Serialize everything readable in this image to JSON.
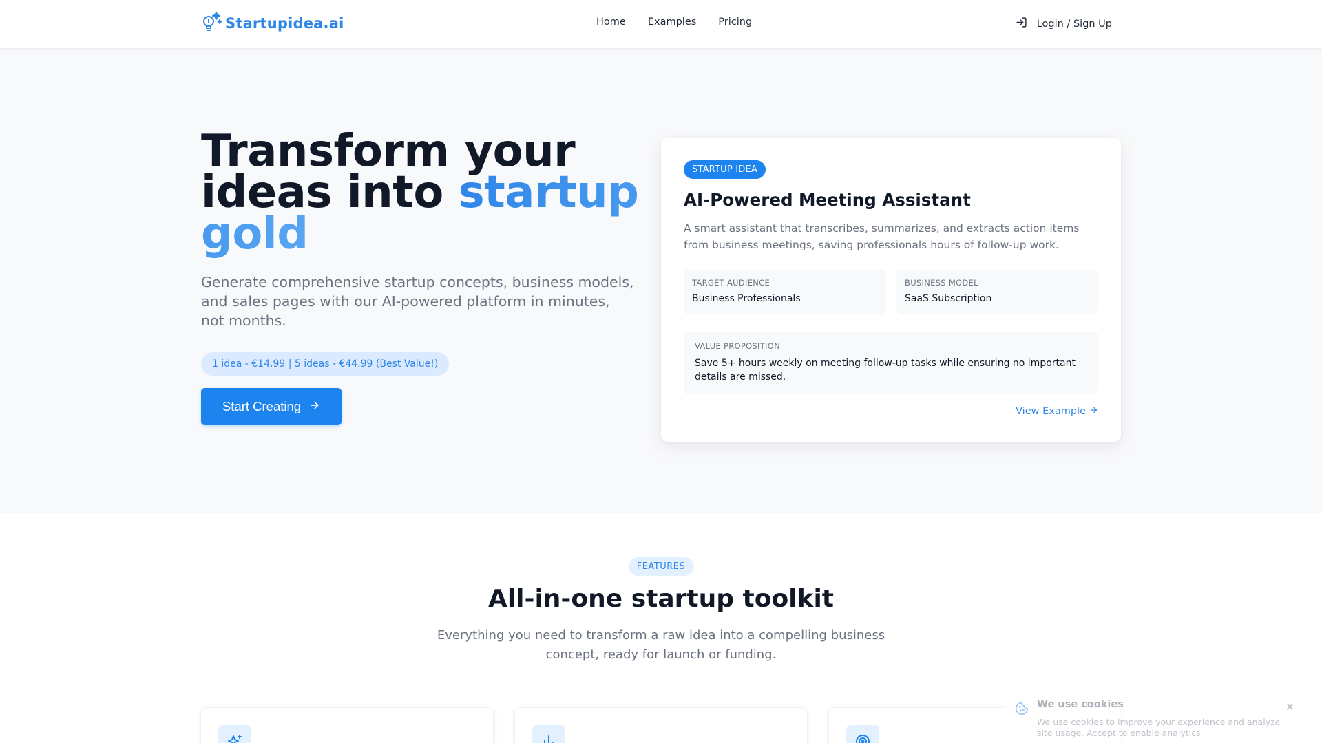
{
  "nav": {
    "logo_text": "Startupidea.ai",
    "links": [
      "Home",
      "Examples",
      "Pricing"
    ],
    "login_label": "Login / Sign Up"
  },
  "hero": {
    "title_line1": "Transform your",
    "title_line2_plain": "ideas into",
    "title_accent": "startup gold",
    "subtitle": "Generate comprehensive startup concepts, business models, and sales pages with our AI-powered platform in minutes, not months.",
    "pricing_pill": "1 idea - €14.99 | 5 ideas - €44.99 (Best Value!)",
    "cta_label": "Start Creating"
  },
  "idea_card": {
    "badge": "STARTUP IDEA",
    "title": "AI-Powered Meeting Assistant",
    "description": "A smart assistant that transcribes, summarizes, and extracts action items from business meetings, saving professionals hours of follow-up work.",
    "target_audience_label": "TARGET AUDIENCE",
    "target_audience_value": "Business Professionals",
    "business_model_label": "BUSINESS MODEL",
    "business_model_value": "SaaS Subscription",
    "value_prop_label": "VALUE PROPOSITION",
    "value_prop_value": "Save 5+ hours weekly on meeting follow-up tasks while ensuring no important details are missed.",
    "link_label": "View Example"
  },
  "features": {
    "pill": "FEATURES",
    "title": "All-in-one startup toolkit",
    "subtitle": "Everything you need to transform a raw idea into a compelling business concept, ready for launch or funding.",
    "card_icons": [
      "sparkle-icon",
      "bar-chart-icon",
      "target-icon"
    ]
  },
  "cookie": {
    "title": "We use cookies",
    "text": "We use cookies to improve your experience and analyze site usage. Accept to enable analytics."
  },
  "colors": {
    "brand_blue": "#1d84ef",
    "accent_text": "#2f86e9",
    "pill_bg": "#dbeafe"
  }
}
